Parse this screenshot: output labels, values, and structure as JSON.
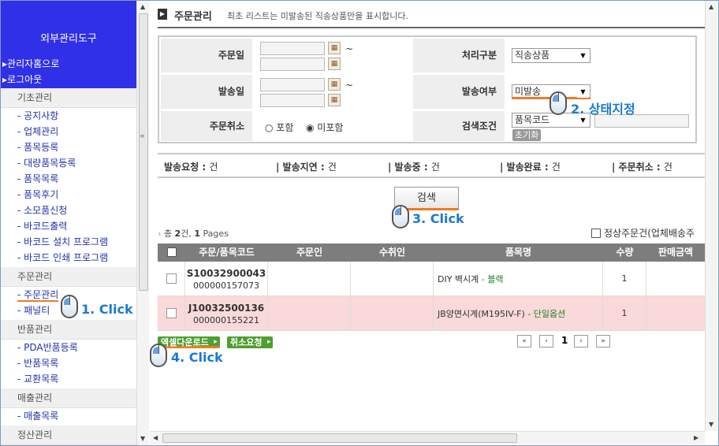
{
  "sidebar": {
    "title": "외부관리도구",
    "links": [
      "▸관리자홈으로",
      "▸로그아웃"
    ],
    "categories": [
      {
        "label": "기초관리",
        "items": [
          "- 공지사항",
          "- 업체관리",
          "- 품목등록",
          "- 대량품목등록",
          "- 품목목록",
          "- 품목후기",
          "- 소모품신청",
          "- 바코드출력",
          "- 바코드 설치 프로그램",
          "- 바코드 인쇄 프로그램"
        ]
      },
      {
        "label": "주문관리",
        "items": [
          "- 주문관리",
          "- 패널티"
        ]
      },
      {
        "label": "반품관리",
        "items": [
          "- PDA반품등록",
          "- 반품목록",
          "- 교환목록"
        ]
      },
      {
        "label": "매출관리",
        "items": [
          "- 매출목록"
        ]
      },
      {
        "label": "정산관리",
        "items": []
      }
    ]
  },
  "header": {
    "icon": "title-arrow-icon",
    "title": "주문관리",
    "description": "최초 리스트는 미발송된 직송상품만을 표시합니다."
  },
  "search": {
    "order_date_label": "주문일",
    "ship_date_label": "발송일",
    "cancel_label": "주문취소",
    "process_label": "처리구분",
    "process_value": "직송상품",
    "shipped_label": "발송여부",
    "shipped_value": "미발송",
    "condition_label": "검색조건",
    "condition_value": "품목코드",
    "reset_label": "초기화",
    "radio_include": "포함",
    "radio_exclude": "미포함",
    "radio_selected": "미포함",
    "tilde": "~"
  },
  "status_bar": [
    {
      "label": "발송요청 :",
      "value": "건"
    },
    {
      "label": "| 발송지연 :",
      "value": "건"
    },
    {
      "label": "| 발송중 :",
      "value": "건"
    },
    {
      "label": "| 발송완료 :",
      "value": "건"
    },
    {
      "label": "| 주문취소 :",
      "value": "건"
    }
  ],
  "search_button": "검색",
  "summary": {
    "prefix": "총 ",
    "count": "2",
    "suffix_mid": "건, ",
    "pages": "1",
    "suffix": " Pages"
  },
  "normal_checkbox_label": "정상주문건(업체배송주",
  "table": {
    "headers": [
      "주문/품목코드",
      "주문인",
      "수취인",
      "품목명",
      "수량",
      "판매금액"
    ],
    "rows": [
      {
        "order": "S10032900043",
        "item": "000000157073",
        "product": "DIY 벽시계",
        "option": " - 블랙",
        "qty": "1"
      },
      {
        "order": "J10032500136",
        "item": "000000155221",
        "product": "JB양면시계(M195IV-F)",
        "option": " - 단일옵션",
        "qty": "1"
      }
    ]
  },
  "actions": {
    "excel": "엑셀다운로드",
    "cancel_request": "취소요청"
  },
  "pager": {
    "first": "«",
    "prev": "‹",
    "current": "1",
    "next": "›",
    "last": "»"
  },
  "callouts": [
    "1. Click",
    "2. 상태지정",
    "3. Click",
    "4. Click"
  ],
  "colors": {
    "sidebar_header": "#3030e8",
    "accent": "#f07a20",
    "callout": "#1a78d4",
    "table_header": "#7d7d7d",
    "row_highlight": "#f9d9d9"
  }
}
